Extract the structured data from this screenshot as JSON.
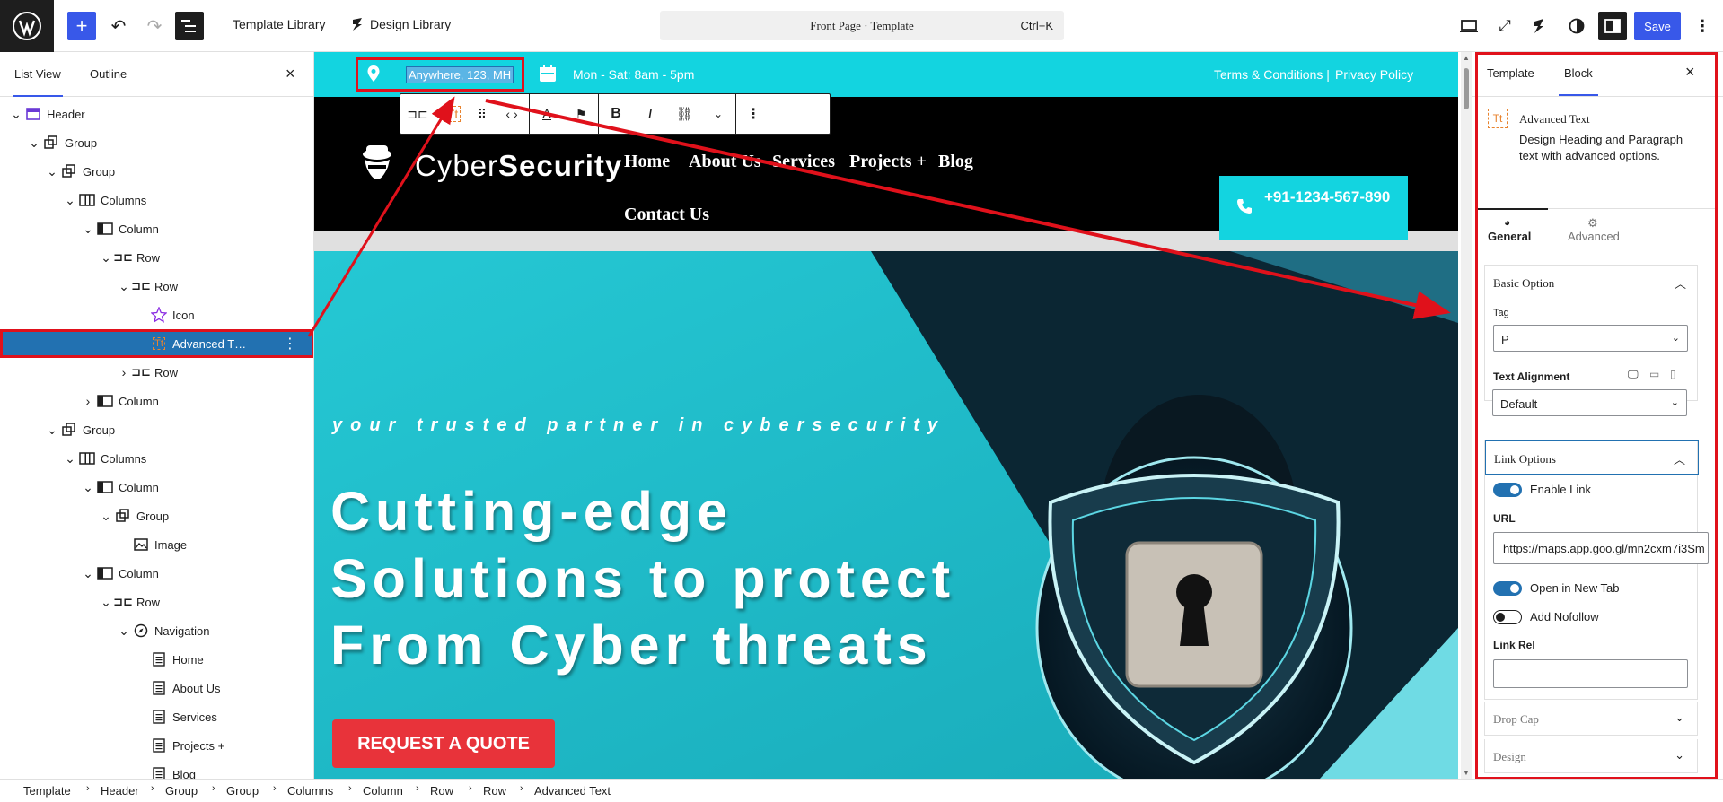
{
  "topbar": {
    "template_library": "Template Library",
    "design_library": "Design Library",
    "command_title": "Front Page · Template",
    "command_shortcut": "Ctrl+K",
    "save": "Save"
  },
  "list_view": {
    "tab_list": "List View",
    "tab_outline": "Outline",
    "items": [
      {
        "label": "Header",
        "icon": "template-part-icon",
        "depth": 0,
        "expanded": true
      },
      {
        "label": "Group",
        "icon": "group-icon",
        "depth": 1,
        "expanded": true
      },
      {
        "label": "Group",
        "icon": "group-icon",
        "depth": 2,
        "expanded": true
      },
      {
        "label": "Columns",
        "icon": "columns-icon",
        "depth": 3,
        "expanded": true
      },
      {
        "label": "Column",
        "icon": "column-icon",
        "depth": 4,
        "expanded": true
      },
      {
        "label": "Row",
        "icon": "row-icon",
        "depth": 5,
        "expanded": true
      },
      {
        "label": "Row",
        "icon": "row-icon",
        "depth": 6,
        "expanded": true
      },
      {
        "label": "Icon",
        "icon": "star-icon",
        "depth": 7,
        "expanded": null
      },
      {
        "label": "Advanced T…",
        "icon": "advanced-text-icon",
        "depth": 7,
        "expanded": null,
        "selected": true
      },
      {
        "label": "Row",
        "icon": "row-icon",
        "depth": 6,
        "expanded": false
      },
      {
        "label": "Column",
        "icon": "column-icon",
        "depth": 4,
        "expanded": false
      },
      {
        "label": "Group",
        "icon": "group-icon",
        "depth": 2,
        "expanded": true
      },
      {
        "label": "Columns",
        "icon": "columns-icon",
        "depth": 3,
        "expanded": true
      },
      {
        "label": "Column",
        "icon": "column-icon",
        "depth": 4,
        "expanded": true
      },
      {
        "label": "Group",
        "icon": "group-icon",
        "depth": 5,
        "expanded": true
      },
      {
        "label": "Image",
        "icon": "image-icon",
        "depth": 6,
        "expanded": null
      },
      {
        "label": "Column",
        "icon": "column-icon",
        "depth": 4,
        "expanded": true
      },
      {
        "label": "Row",
        "icon": "row-icon",
        "depth": 5,
        "expanded": true
      },
      {
        "label": "Navigation",
        "icon": "navigation-icon",
        "depth": 6,
        "expanded": true
      },
      {
        "label": "Home",
        "icon": "page-icon",
        "depth": 7,
        "expanded": null
      },
      {
        "label": "About Us",
        "icon": "page-icon",
        "depth": 7,
        "expanded": null
      },
      {
        "label": "Services",
        "icon": "page-icon",
        "depth": 7,
        "expanded": null
      },
      {
        "label": "Projects +",
        "icon": "page-icon",
        "depth": 7,
        "expanded": null
      },
      {
        "label": "Blog",
        "icon": "page-icon",
        "depth": 7,
        "expanded": null
      }
    ]
  },
  "canvas": {
    "address": "Anywhere, 123, MH",
    "hours": "Mon - Sat: 8am - 5pm",
    "terms": "Terms & Conditions |",
    "privacy": "Privacy Policy",
    "logo_light": "Cyber",
    "logo_bold": "Security",
    "nav": {
      "home": "Home",
      "about": "About Us",
      "services": "Services",
      "projects": "Projects +",
      "blog": "Blog",
      "contact": "Contact Us"
    },
    "phone": "+91-1234-567-890",
    "hero_sub": "your trusted partner in cybersecurity",
    "hero_line1": "Cutting-edge",
    "hero_line2": "Solutions to protect",
    "hero_line3": "From Cyber threats",
    "cta": "REQUEST A QUOTE"
  },
  "inspector": {
    "tab_template": "Template",
    "tab_block": "Block",
    "block_name": "Advanced Text",
    "block_desc": "Design Heading and Paragraph text with advanced options.",
    "tab_general": "General",
    "tab_advanced": "Advanced",
    "basic_option": "Basic Option",
    "tag_label": "Tag",
    "tag_value": "P",
    "align_label": "Text Alignment",
    "align_value": "Default",
    "link_options": "Link Options",
    "enable_link": "Enable Link",
    "url_label": "URL",
    "url_value": "https://maps.app.goo.gl/mn2cxm7i3Sm",
    "new_tab": "Open in New Tab",
    "nofollow": "Add Nofollow",
    "link_rel": "Link Rel",
    "drop_cap": "Drop Cap",
    "design": "Design",
    "enable_link_on": true,
    "new_tab_on": true,
    "nofollow_on": false
  },
  "breadcrumb": [
    "Template",
    "Header",
    "Group",
    "Group",
    "Columns",
    "Column",
    "Row",
    "Row",
    "Advanced Text"
  ],
  "colors": {
    "accent": "#3858e9",
    "teal": "#13d4e0",
    "annotation": "#e0111b",
    "selected": "#2271b1",
    "cta": "#e8333a"
  }
}
